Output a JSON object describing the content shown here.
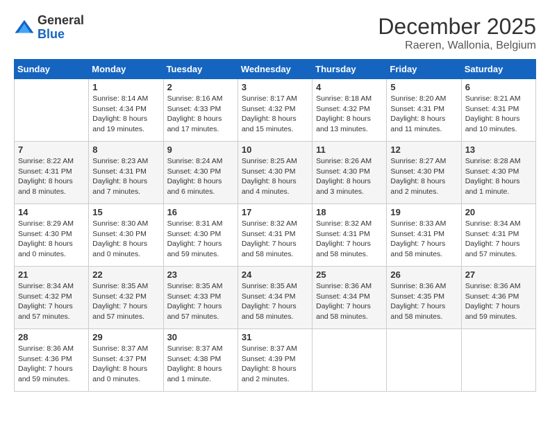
{
  "header": {
    "logo_general": "General",
    "logo_blue": "Blue",
    "month": "December 2025",
    "location": "Raeren, Wallonia, Belgium"
  },
  "weekdays": [
    "Sunday",
    "Monday",
    "Tuesday",
    "Wednesday",
    "Thursday",
    "Friday",
    "Saturday"
  ],
  "weeks": [
    [
      {
        "day": "",
        "info": ""
      },
      {
        "day": "1",
        "info": "Sunrise: 8:14 AM\nSunset: 4:34 PM\nDaylight: 8 hours\nand 19 minutes."
      },
      {
        "day": "2",
        "info": "Sunrise: 8:16 AM\nSunset: 4:33 PM\nDaylight: 8 hours\nand 17 minutes."
      },
      {
        "day": "3",
        "info": "Sunrise: 8:17 AM\nSunset: 4:32 PM\nDaylight: 8 hours\nand 15 minutes."
      },
      {
        "day": "4",
        "info": "Sunrise: 8:18 AM\nSunset: 4:32 PM\nDaylight: 8 hours\nand 13 minutes."
      },
      {
        "day": "5",
        "info": "Sunrise: 8:20 AM\nSunset: 4:31 PM\nDaylight: 8 hours\nand 11 minutes."
      },
      {
        "day": "6",
        "info": "Sunrise: 8:21 AM\nSunset: 4:31 PM\nDaylight: 8 hours\nand 10 minutes."
      }
    ],
    [
      {
        "day": "7",
        "info": "Sunrise: 8:22 AM\nSunset: 4:31 PM\nDaylight: 8 hours\nand 8 minutes."
      },
      {
        "day": "8",
        "info": "Sunrise: 8:23 AM\nSunset: 4:31 PM\nDaylight: 8 hours\nand 7 minutes."
      },
      {
        "day": "9",
        "info": "Sunrise: 8:24 AM\nSunset: 4:30 PM\nDaylight: 8 hours\nand 6 minutes."
      },
      {
        "day": "10",
        "info": "Sunrise: 8:25 AM\nSunset: 4:30 PM\nDaylight: 8 hours\nand 4 minutes."
      },
      {
        "day": "11",
        "info": "Sunrise: 8:26 AM\nSunset: 4:30 PM\nDaylight: 8 hours\nand 3 minutes."
      },
      {
        "day": "12",
        "info": "Sunrise: 8:27 AM\nSunset: 4:30 PM\nDaylight: 8 hours\nand 2 minutes."
      },
      {
        "day": "13",
        "info": "Sunrise: 8:28 AM\nSunset: 4:30 PM\nDaylight: 8 hours\nand 1 minute."
      }
    ],
    [
      {
        "day": "14",
        "info": "Sunrise: 8:29 AM\nSunset: 4:30 PM\nDaylight: 8 hours\nand 0 minutes."
      },
      {
        "day": "15",
        "info": "Sunrise: 8:30 AM\nSunset: 4:30 PM\nDaylight: 8 hours\nand 0 minutes."
      },
      {
        "day": "16",
        "info": "Sunrise: 8:31 AM\nSunset: 4:30 PM\nDaylight: 7 hours\nand 59 minutes."
      },
      {
        "day": "17",
        "info": "Sunrise: 8:32 AM\nSunset: 4:31 PM\nDaylight: 7 hours\nand 58 minutes."
      },
      {
        "day": "18",
        "info": "Sunrise: 8:32 AM\nSunset: 4:31 PM\nDaylight: 7 hours\nand 58 minutes."
      },
      {
        "day": "19",
        "info": "Sunrise: 8:33 AM\nSunset: 4:31 PM\nDaylight: 7 hours\nand 58 minutes."
      },
      {
        "day": "20",
        "info": "Sunrise: 8:34 AM\nSunset: 4:31 PM\nDaylight: 7 hours\nand 57 minutes."
      }
    ],
    [
      {
        "day": "21",
        "info": "Sunrise: 8:34 AM\nSunset: 4:32 PM\nDaylight: 7 hours\nand 57 minutes."
      },
      {
        "day": "22",
        "info": "Sunrise: 8:35 AM\nSunset: 4:32 PM\nDaylight: 7 hours\nand 57 minutes."
      },
      {
        "day": "23",
        "info": "Sunrise: 8:35 AM\nSunset: 4:33 PM\nDaylight: 7 hours\nand 57 minutes."
      },
      {
        "day": "24",
        "info": "Sunrise: 8:35 AM\nSunset: 4:34 PM\nDaylight: 7 hours\nand 58 minutes."
      },
      {
        "day": "25",
        "info": "Sunrise: 8:36 AM\nSunset: 4:34 PM\nDaylight: 7 hours\nand 58 minutes."
      },
      {
        "day": "26",
        "info": "Sunrise: 8:36 AM\nSunset: 4:35 PM\nDaylight: 7 hours\nand 58 minutes."
      },
      {
        "day": "27",
        "info": "Sunrise: 8:36 AM\nSunset: 4:36 PM\nDaylight: 7 hours\nand 59 minutes."
      }
    ],
    [
      {
        "day": "28",
        "info": "Sunrise: 8:36 AM\nSunset: 4:36 PM\nDaylight: 7 hours\nand 59 minutes."
      },
      {
        "day": "29",
        "info": "Sunrise: 8:37 AM\nSunset: 4:37 PM\nDaylight: 8 hours\nand 0 minutes."
      },
      {
        "day": "30",
        "info": "Sunrise: 8:37 AM\nSunset: 4:38 PM\nDaylight: 8 hours\nand 1 minute."
      },
      {
        "day": "31",
        "info": "Sunrise: 8:37 AM\nSunset: 4:39 PM\nDaylight: 8 hours\nand 2 minutes."
      },
      {
        "day": "",
        "info": ""
      },
      {
        "day": "",
        "info": ""
      },
      {
        "day": "",
        "info": ""
      }
    ]
  ]
}
